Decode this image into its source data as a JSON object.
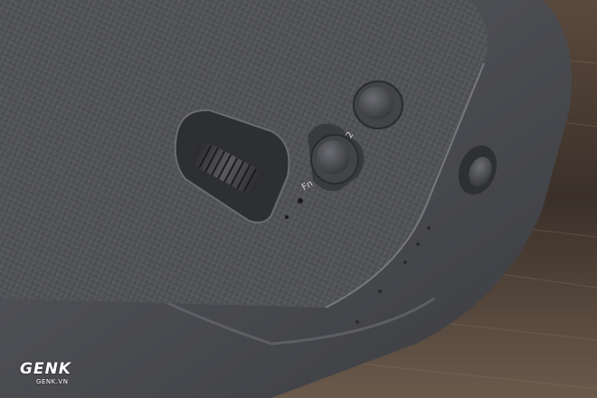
{
  "labels": {
    "fn": "Fn",
    "two": "2"
  },
  "watermark": {
    "brand": "GENK",
    "site": "GENK.VN"
  },
  "colors": {
    "body": "#4a4b4f",
    "panel": "#55565a",
    "wood": "#3a2f28",
    "button": "#3d3e42"
  }
}
